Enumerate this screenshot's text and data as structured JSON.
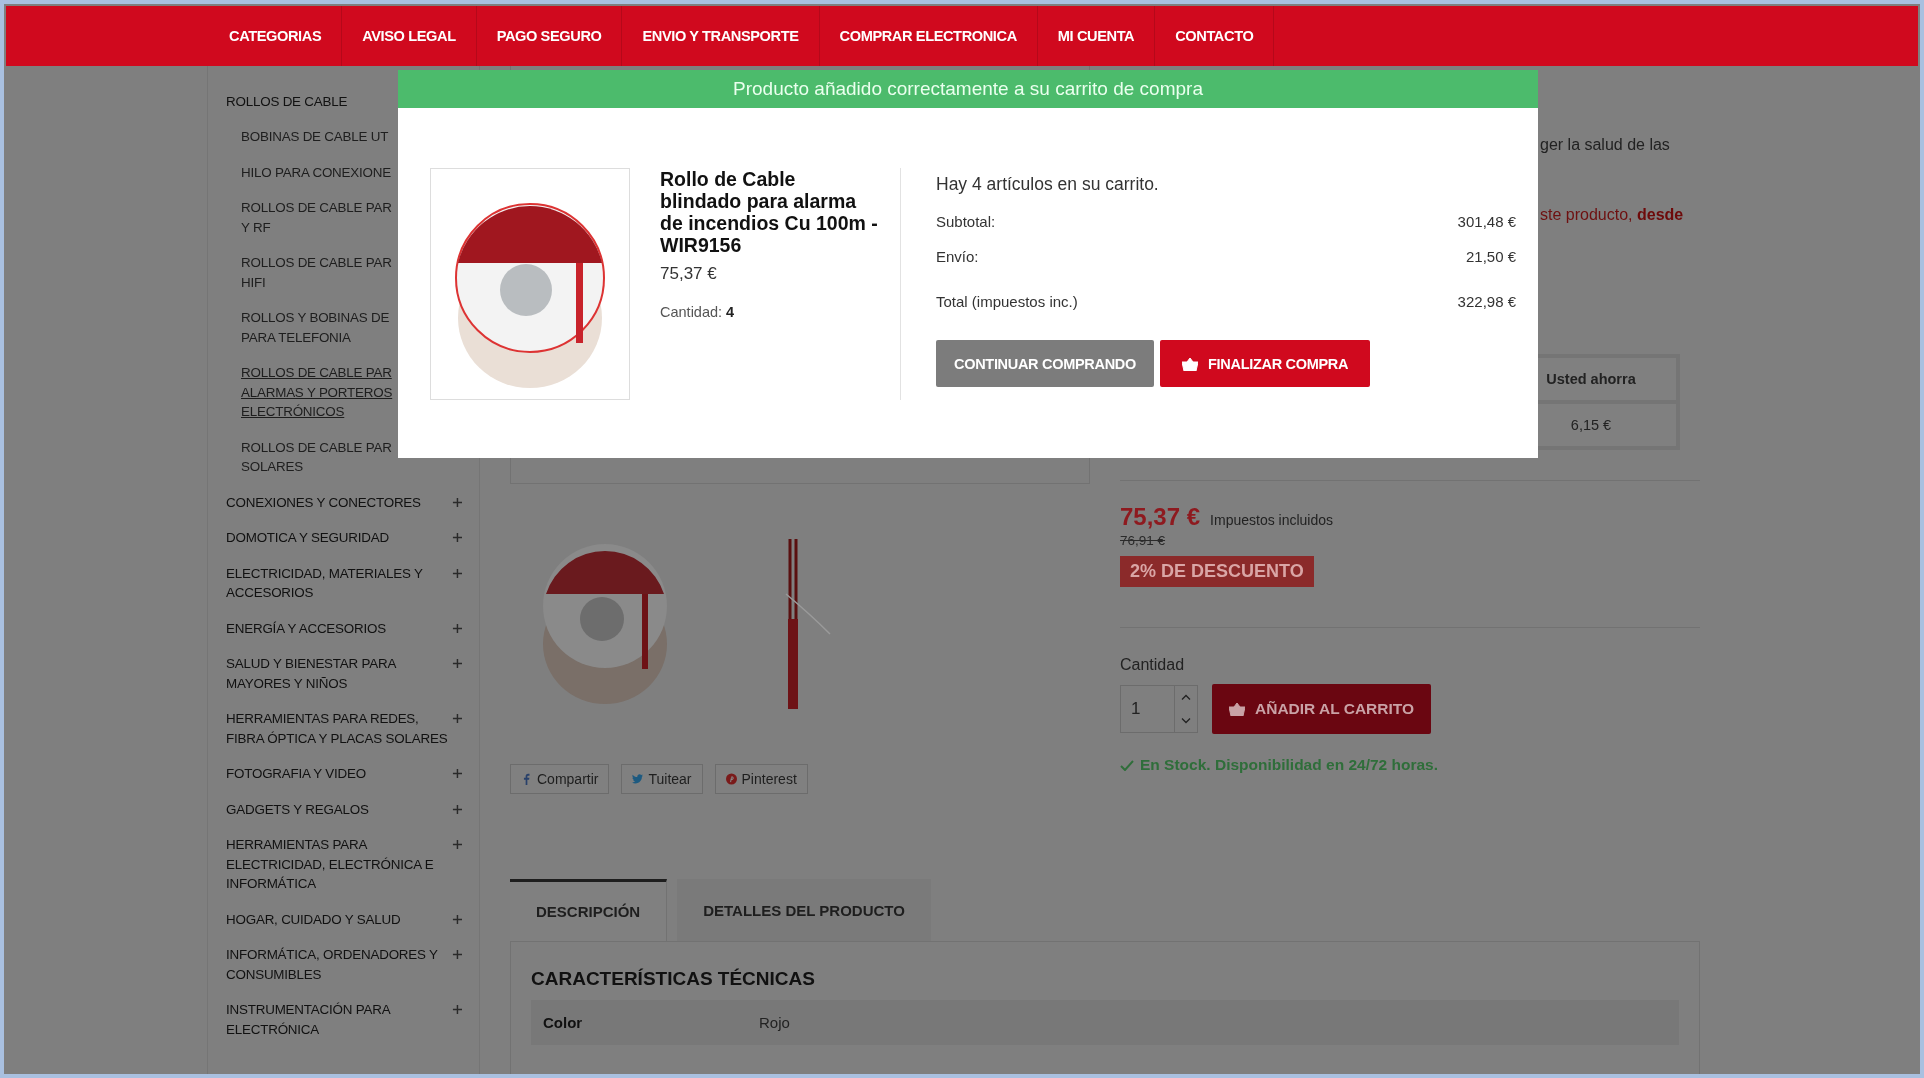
{
  "nav": {
    "items": [
      "CATEGORIAS",
      "AVISO LEGAL",
      "PAGO SEGURO",
      "ENVIO Y TRANSPORTE",
      "COMPRAR ELECTRONICA",
      "MI CUENTA",
      "CONTACTO"
    ]
  },
  "sidebar": {
    "category": "ROLLOS DE CABLE",
    "subcategories": [
      {
        "lines": [
          "BOBINAS DE CABLE UT"
        ],
        "selected": false
      },
      {
        "lines": [
          "HILO PARA CONEXIONE"
        ],
        "selected": false
      },
      {
        "lines": [
          "ROLLOS DE CABLE PAR",
          "Y RF"
        ],
        "selected": false
      },
      {
        "lines": [
          "ROLLOS DE CABLE PAR",
          "HIFI"
        ],
        "selected": false
      },
      {
        "lines": [
          "ROLLOS Y BOBINAS DE",
          "PARA TELEFONIA"
        ],
        "selected": false
      },
      {
        "lines": [
          "ROLLOS DE CABLE PAR",
          "ALARMAS Y PORTEROS",
          "ELECTRÓNICOS"
        ],
        "selected": true
      },
      {
        "lines": [
          "ROLLOS DE CABLE PAR",
          "SOLARES"
        ],
        "selected": false
      }
    ],
    "categories": [
      {
        "label": "CONEXIONES Y CONECTORES",
        "expanded": false
      },
      {
        "label": "DOMOTICA Y SEGURIDAD",
        "expanded": false
      },
      {
        "label": "ELECTRICIDAD, MATERIALES Y ACCESORIOS",
        "expanded": false
      },
      {
        "label": "ENERGÍA Y ACCESORIOS",
        "expanded": false
      },
      {
        "label": "SALUD Y BIENESTAR PARA MAYORES Y NIÑOS",
        "expanded": false
      },
      {
        "label": "HERRAMIENTAS PARA REDES, FIBRA ÓPTICA Y PLACAS SOLARES",
        "expanded": false
      },
      {
        "label": "FOTOGRAFIA Y VIDEO",
        "expanded": false
      },
      {
        "label": "GADGETS Y REGALOS",
        "expanded": false
      },
      {
        "label": "HERRAMIENTAS PARA ELECTRICIDAD, ELECTRÓNICA E INFORMÁTICA",
        "expanded": false
      },
      {
        "label": "HOGAR, CUIDADO Y SALUD",
        "expanded": false
      },
      {
        "label": "INFORMÁTICA, ORDENADORES Y CONSUMIBLES",
        "expanded": false
      },
      {
        "label": "INSTRUMENTACIÓN PARA ELECTRÓNICA",
        "expanded": false
      }
    ]
  },
  "product": {
    "description_fragments": [
      "ger la salud de las",
      "ste producto, **desde**"
    ],
    "savings_table": {
      "header": "Usted ahorra",
      "value": "6,15 €"
    },
    "share": [
      {
        "kind": "facebook",
        "label": "Compartir"
      },
      {
        "kind": "twitter",
        "label": "Tuitear"
      },
      {
        "kind": "pinterest",
        "label": "Pinterest"
      }
    ],
    "price": "75,37 €",
    "tax_note": "Impuestos incluidos",
    "old_price": "76,91 €",
    "discount": "2% DE DESCUENTO",
    "quantity_label": "Cantidad",
    "quantity": "1",
    "add_button": "AÑADIR AL CARRITO",
    "stock": "En Stock. Disponibilidad en 24/72 horas."
  },
  "tabs": [
    {
      "label": "DESCRIPCIÓN",
      "selected": true
    },
    {
      "label": "DETALLES DEL PRODUCTO",
      "selected": false
    }
  ],
  "specs": {
    "title": "CARACTERÍSTICAS TÉCNICAS",
    "rows": [
      {
        "name": "Color",
        "value": "Rojo"
      }
    ]
  },
  "modal": {
    "banner": "Producto añadido correctamente a su carrito de compra",
    "product_title": "Rollo de Cable blindado para alarma de incendios Cu 100m - WIR9156",
    "price": "75,37 €",
    "quantity": "Cantidad: **4**",
    "cart_summary": "Hay 4 artículos en su carrito.",
    "lines": [
      {
        "kind": "subtotal",
        "label": "Subtotal:",
        "value": "301,48 €"
      },
      {
        "kind": "shipping",
        "label": "Envío:",
        "value": "21,50 €"
      },
      {
        "kind": "total",
        "label": "Total (impuestos inc.)",
        "value": "322,98 €"
      }
    ],
    "buttons": [
      {
        "kind": "secondary",
        "label": "CONTINUAR COMPRANDO"
      },
      {
        "kind": "checkout",
        "label": "FINALIZAR COMPRA"
      }
    ]
  }
}
